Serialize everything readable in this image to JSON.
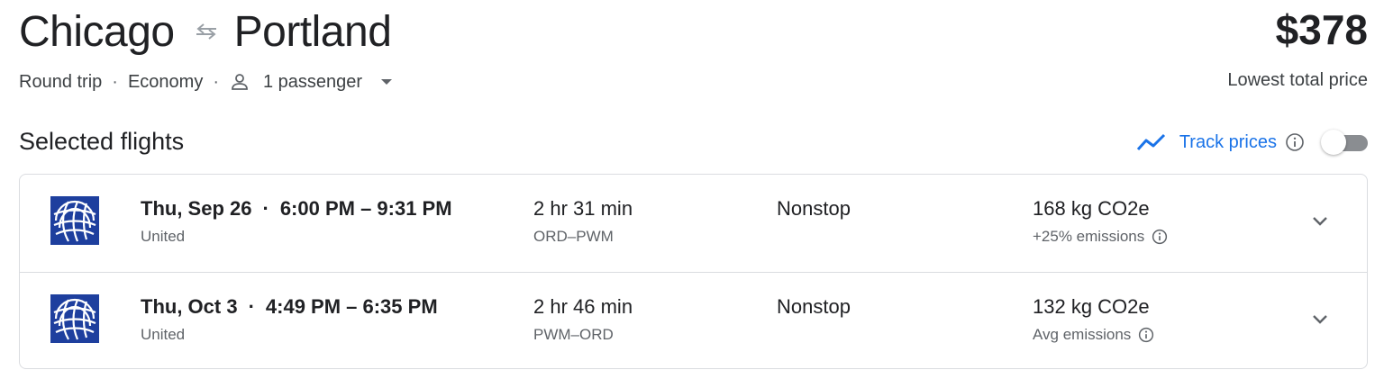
{
  "header": {
    "origin": "Chicago",
    "destination": "Portland",
    "price": "$378",
    "price_caption": "Lowest total price",
    "trip_type": "Round trip",
    "cabin": "Economy",
    "passengers": "1 passenger",
    "separator": "·"
  },
  "section": {
    "title": "Selected flights",
    "track_label": "Track prices",
    "track_enabled": false
  },
  "flights": [
    {
      "date": "Thu, Sep 26",
      "times": "6:00 PM – 9:31 PM",
      "airline": "United",
      "duration": "2 hr 31 min",
      "route": "ORD–PWM",
      "stops": "Nonstop",
      "emissions": "168 kg CO2e",
      "emissions_note": "+25% emissions"
    },
    {
      "date": "Thu, Oct 3",
      "times": "4:49 PM – 6:35 PM",
      "airline": "United",
      "duration": "2 hr 46 min",
      "route": "PWM–ORD",
      "stops": "Nonstop",
      "emissions": "132 kg CO2e",
      "emissions_note": "Avg emissions"
    }
  ],
  "colors": {
    "accent": "#1a73e8",
    "united_blue": "#1e3f9e",
    "text_primary": "#202124",
    "text_secondary": "#5f6368",
    "border": "#dadce0"
  },
  "icons": {
    "swap": "swap-arrows-icon",
    "person": "person-icon",
    "caret": "caret-down-icon",
    "track": "trend-line-icon",
    "info": "info-icon",
    "expand": "chevron-down-icon",
    "airline": "united-logo"
  }
}
